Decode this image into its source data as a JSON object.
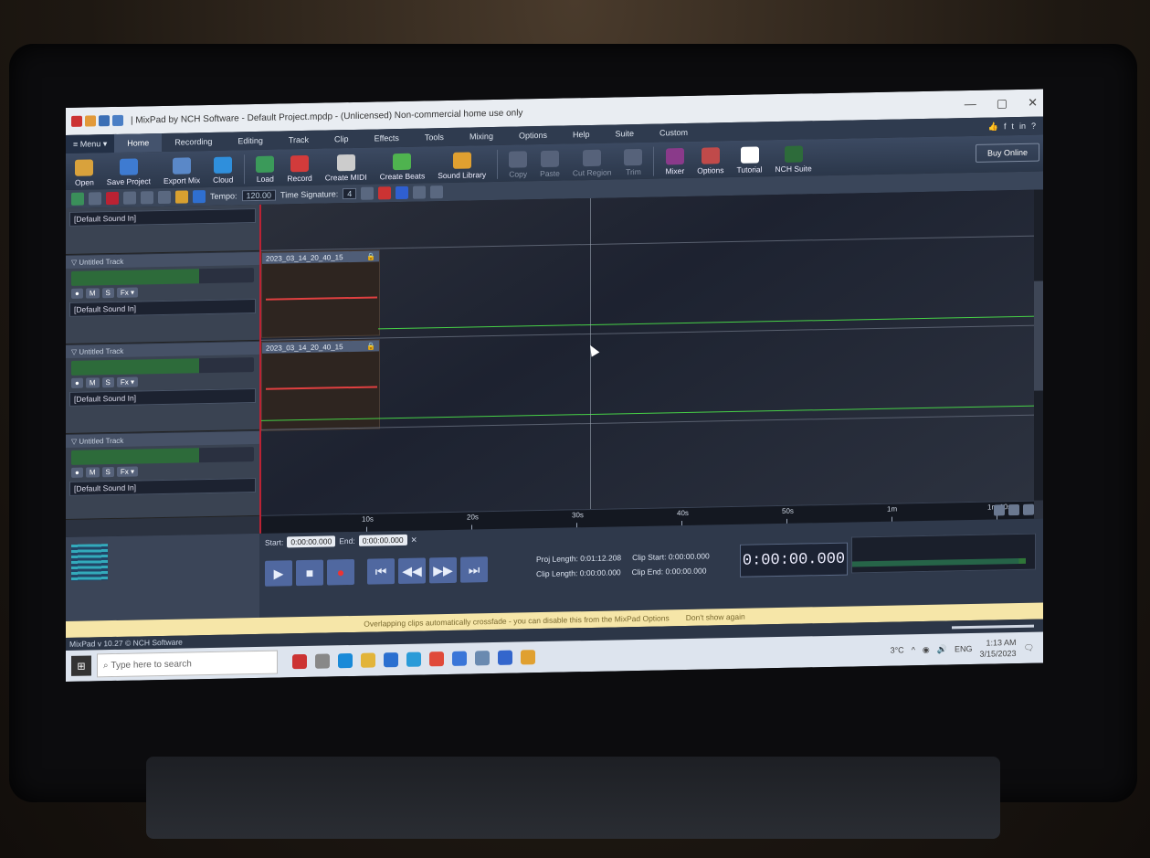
{
  "window": {
    "title": "| MixPad by NCH Software - Default Project.mpdp - (Unlicensed) Non-commercial home use only",
    "minimize": "—",
    "maximize": "▢",
    "close": "✕"
  },
  "menu": {
    "menu_label": "≡ Menu ▾",
    "tabs": [
      "Home",
      "Recording",
      "Editing",
      "Track",
      "Clip",
      "Effects",
      "Tools",
      "Mixing",
      "Options",
      "Help",
      "Suite",
      "Custom"
    ],
    "help_icon": "?"
  },
  "ribbon": {
    "buttons": [
      "Open",
      "Save Project",
      "Export Mix",
      "Cloud",
      "Load",
      "Record",
      "Create MIDI",
      "Create Beats",
      "Sound Library"
    ],
    "dim_buttons": [
      "Copy",
      "Paste",
      "Cut Region",
      "Trim"
    ],
    "right_buttons": [
      "Mixer",
      "Options",
      "Tutorial",
      "NCH Suite"
    ],
    "buy_online": "Buy Online"
  },
  "toolbar": {
    "tempo_label": "Tempo:",
    "tempo_value": "120.00",
    "time_sig_label": "Time Signature:",
    "time_sig_value": "4"
  },
  "tracks": [
    {
      "name": "",
      "input": "[Default Sound In]"
    },
    {
      "name": "▽ Untitled Track",
      "input": "[Default Sound In]",
      "clip": "2023_03_14_20_40_15"
    },
    {
      "name": "▽ Untitled Track",
      "input": "[Default Sound In]",
      "clip": "2023_03_14_20_40_15"
    },
    {
      "name": "▽ Untitled Track",
      "input": "[Default Sound In]"
    }
  ],
  "track_buttons": {
    "record": "●",
    "mute": "M",
    "solo": "S",
    "fx": "Fx ▾"
  },
  "ruler": {
    "labels": [
      "10s",
      "20s",
      "30s",
      "40s",
      "50s",
      "1m",
      "1m:10s"
    ]
  },
  "transport": {
    "start_label": "Start:",
    "start_value": "0:00:00.000",
    "end_label": "End:",
    "end_value": "0:00:00.000",
    "proj_length_label": "Proj Length:",
    "proj_length_value": "0:01:12.208",
    "clip_start_label": "Clip Start:",
    "clip_start_value": "0:00:00.000",
    "clip_length_label": "Clip Length:",
    "clip_length_value": "0:00:00.000",
    "clip_end_label": "Clip End:",
    "clip_end_value": "0:00:00.000",
    "clock": "0:00:00.000",
    "play": "▶",
    "stop": "■",
    "rec": "●",
    "to_start": "⏮",
    "rewind": "◀◀",
    "forward": "▶▶",
    "to_end": "⏭"
  },
  "notice": {
    "text": "Overlapping clips automatically crossfade - you can disable this from the MixPad Options",
    "link": "Don't show again"
  },
  "status": {
    "version": "MixPad v 10.27 © NCH Software"
  },
  "taskbar": {
    "search_placeholder": "Type here to search",
    "weather": "3°C",
    "lang": "ENG",
    "time": "1:13 AM",
    "date": "3/15/2023"
  }
}
